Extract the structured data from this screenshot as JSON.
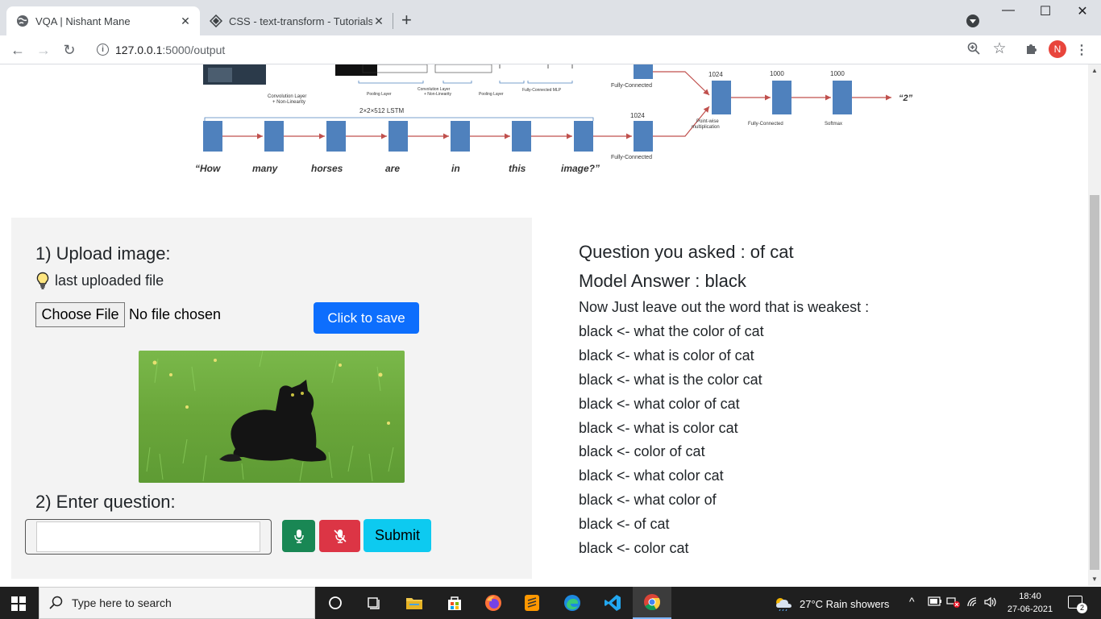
{
  "browser": {
    "tabs": [
      {
        "title": "VQA | Nishant Mane",
        "active": true
      },
      {
        "title": "CSS - text-transform - Tutorialspoint",
        "active": false
      }
    ],
    "new_tab": "+",
    "window_controls": {
      "minimize": "—",
      "maximize": "☐",
      "close": "✕"
    },
    "url_host": "127.0.0.1",
    "url_rest": ":5000/output",
    "profile_initial": "N"
  },
  "diagram": {
    "caption_conv1": "Convolution Layer",
    "caption_conv1b": "+ Non-Linearity",
    "caption_pool": "Pooling Layer",
    "caption_conv2": "Convolution Layer",
    "caption_conv2b": "+ Non-Linearity",
    "caption_pool2": "Pooling Layer",
    "caption_mlp": "Fully-Connected MLP",
    "fc_top": "Fully-Connected",
    "fc_bottom": "Fully-Connected",
    "lstm_label": "2×2×512 LSTM",
    "n_1024a": "1024",
    "n_1024b": "1024",
    "n_1000a": "1000",
    "n_1000b": "1000",
    "pointwise": "Point-wise",
    "multiplication": "multiplication",
    "fc_right": "Fully-Connected",
    "softmax": "Softmax",
    "output": "“2”",
    "words": [
      "“How",
      "many",
      "horses",
      "are",
      "in",
      "this",
      "image?”"
    ]
  },
  "form": {
    "upload_heading": "1) Upload image:",
    "last_file": "last uploaded file",
    "choose_file": "Choose File",
    "no_file": "No file chosen",
    "save_button": "Click to save",
    "question_heading": "2) Enter question:",
    "question_value": "",
    "submit": "Submit"
  },
  "result": {
    "asked": "Question you asked : of cat",
    "answer": "Model Answer : black",
    "leave_out": "Now Just leave out the word that is weakest :",
    "variants": [
      "black <- what the color of cat",
      "black <- what is color of cat",
      "black <- what is the color cat",
      "black <- what color of cat",
      "black <- what is color cat",
      "black <- color of cat",
      "black <- what color cat",
      "black <- what color of",
      "black <- of cat",
      "black <- color cat"
    ]
  },
  "taskbar": {
    "search_placeholder": "Type here to search",
    "weather": "27°C  Rain showers",
    "time": "18:40",
    "date": "27-06-2021",
    "notifications": "2"
  },
  "colors": {
    "primary": "#0d6efd",
    "success": "#198754",
    "danger": "#dc3545",
    "info": "#0dcaf0",
    "diagram_block": "#4f81bd",
    "diagram_arrow": "#c0504d"
  }
}
